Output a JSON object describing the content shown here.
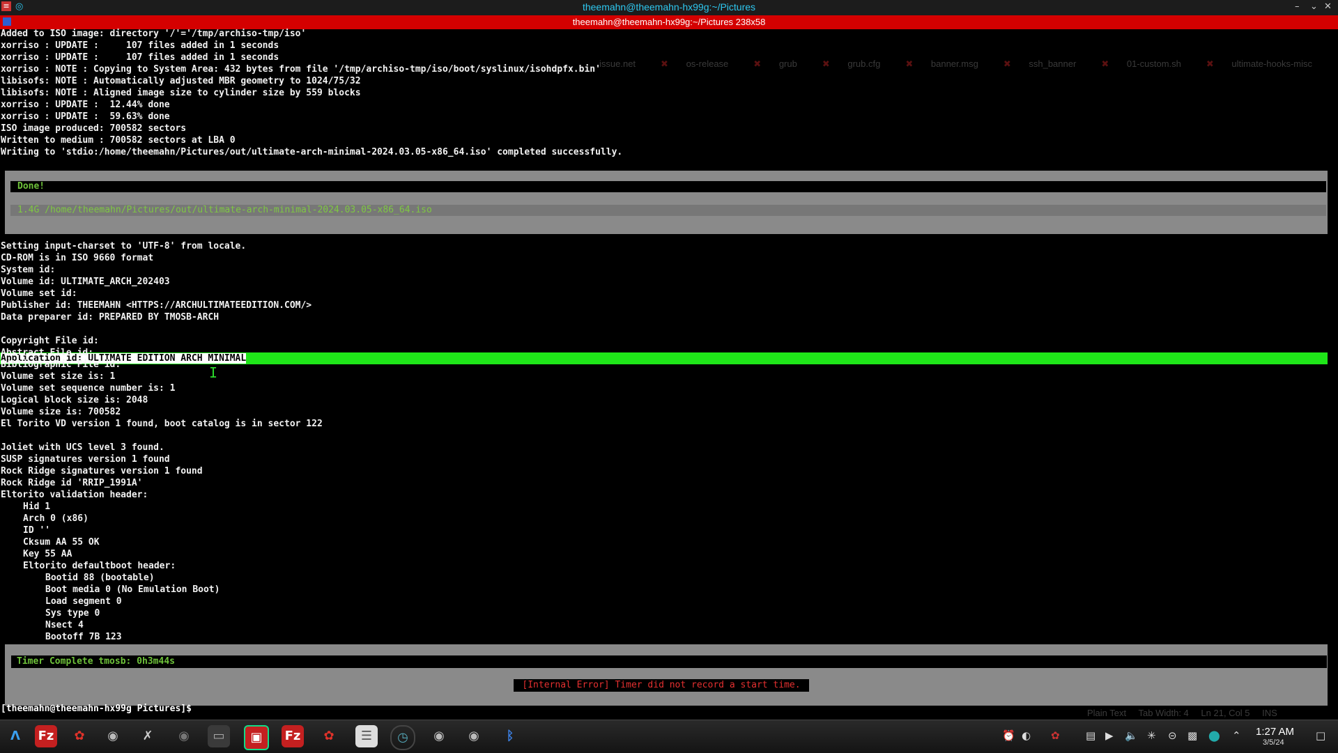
{
  "window": {
    "title": "theemahn@theemahn-hx99g:~/Pictures",
    "tab_title": "theemahn@theemahn-hx99g:~/Pictures 238x58"
  },
  "background_editor": {
    "tabs": [
      "issue.net",
      "os-release",
      "grub",
      "grub.cfg",
      "banner.msg",
      "ssh_banner",
      "01-custom.sh",
      "ultimate-hooks-misc"
    ],
    "status": {
      "syntax": "Plain Text",
      "tab_width": "Tab Width: 4",
      "position": "Ln 21, Col 5",
      "mode": "INS"
    }
  },
  "terminal": {
    "output_top": [
      "Added to ISO image: directory '/'='/tmp/archiso-tmp/iso'",
      "xorriso : UPDATE :     107 files added in 1 seconds",
      "xorriso : UPDATE :     107 files added in 1 seconds",
      "xorriso : NOTE : Copying to System Area: 432 bytes from file '/tmp/archiso-tmp/iso/boot/syslinux/isohdpfx.bin'",
      "libisofs: NOTE : Automatically adjusted MBR geometry to 1024/75/32",
      "libisofs: NOTE : Aligned image size to cylinder size by 559 blocks",
      "xorriso : UPDATE :  12.44% done",
      "xorriso : UPDATE :  59.63% done",
      "ISO image produced: 700582 sectors",
      "Written to medium : 700582 sectors at LBA 0",
      "Writing to 'stdio:/home/theemahn/Pictures/out/ultimate-arch-minimal-2024.03.05-x86_64.iso' completed successfully."
    ],
    "done_label": "Done!",
    "iso_result": "1.4G /home/theemahn/Pictures/out/ultimate-arch-minimal-2024.03.05-x86_64.iso",
    "output_mid": [
      "Setting input-charset to 'UTF-8' from locale.",
      "CD-ROM is in ISO 9660 format",
      "System id:",
      "Volume id: ULTIMATE_ARCH_202403",
      "Volume set id:",
      "Publisher id: THEEMAHN <HTTPS://ARCHULTIMATEEDITION.COM/>",
      "Data preparer id: PREPARED BY TMOSB-ARCH"
    ],
    "highlighted_line": "Application id: ULTIMATE EDITION ARCH MINIMAL",
    "output_after": [
      "Copyright File id:",
      "Abstract File id:",
      "Bibliographic File id:",
      "Volume set size is: 1",
      "Volume set sequence number is: 1",
      "Logical block size is: 2048",
      "Volume size is: 700582",
      "El Torito VD version 1 found, boot catalog is in sector 122",
      "",
      "Joliet with UCS level 3 found.",
      "SUSP signatures version 1 found",
      "Rock Ridge signatures version 1 found",
      "Rock Ridge id 'RRIP_1991A'",
      "Eltorito validation header:"
    ],
    "validation_header": [
      "Hid 1",
      "Arch 0 (x86)",
      "ID ''",
      "Cksum AA 55 OK",
      "Key 55 AA",
      "Eltorito defaultboot header:"
    ],
    "defaultboot_header": [
      "Bootid 88 (bootable)",
      "Boot media 0 (No Emulation Boot)",
      "Load segment 0",
      "Sys type 0",
      "Nsect 4",
      "Bootoff 7B 123"
    ],
    "timer_complete": "Timer Complete tmosb: 0h3m44s",
    "internal_error": "[Internal Error] Timer did not record a start time.",
    "prompt": "[theemahn@theemahn-hx99g Pictures]$"
  },
  "taskbar": {
    "apps": [
      "app-launcher-icon",
      "filezilla-icon",
      "strawberry-icon",
      "chrome-icon",
      "tools-icon",
      "disk-icon",
      "files-icon",
      "terminal-icon",
      "filezilla-icon",
      "strawberry-icon",
      "notes-icon",
      "clock-icon",
      "chrome-icon",
      "chrome-icon",
      "bluetooth-icon"
    ],
    "clock_time": "1:27 AM",
    "clock_date": "3/5/24"
  },
  "colors": {
    "title_accent": "#2ec8f0",
    "tab_bar": "#d40000",
    "highlight": "#1fe619",
    "done_green": "#6ec23a",
    "error_red": "#e53030"
  }
}
